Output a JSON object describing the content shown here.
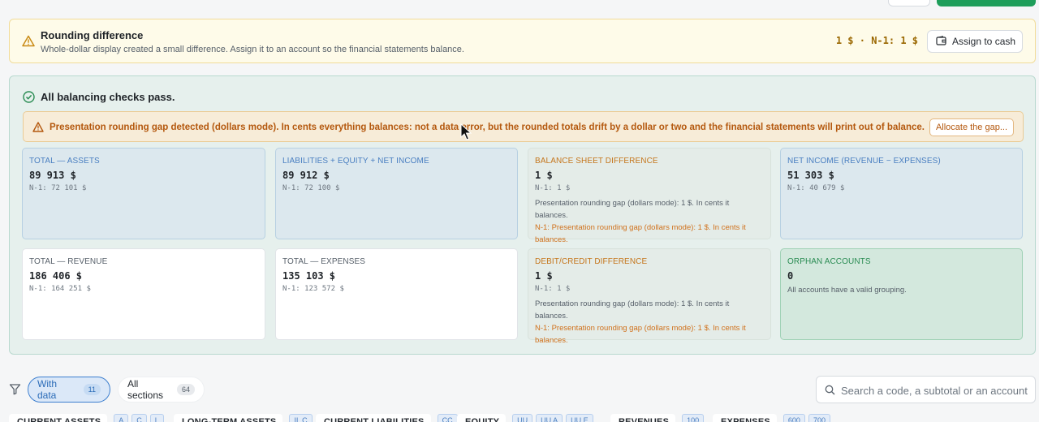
{
  "rounding_banner": {
    "title": "Rounding difference",
    "subtitle": "Whole-dollar display created a small difference. Assign it to an account so the financial statements balance.",
    "amount": "1 $ · N-1: 1 $",
    "assign_label": "Assign to cash"
  },
  "checks": {
    "title": "All balancing checks pass.",
    "alert_text": "Presentation rounding gap detected (dollars mode). In cents everything balances: not a data error, but the rounded totals drift by a dollar or two and the financial statements will print out of balance.",
    "alert_button": "Allocate the gap..."
  },
  "cards": [
    {
      "label": "TOTAL — ASSETS",
      "value": "89 913 $",
      "n1": "N-1: 72 101 $"
    },
    {
      "label": "LIABILITIES + EQUITY + NET INCOME",
      "value": "89 912 $",
      "n1": "N-1: 72 100 $"
    },
    {
      "label": "BALANCE SHEET DIFFERENCE",
      "value": "1 $",
      "n1": "N-1: 1 $",
      "note": "Presentation rounding gap (dollars mode): 1 $. In cents it balances.",
      "note_n1": "N-1: Presentation rounding gap (dollars mode): 1 $. In cents it balances."
    },
    {
      "label": "NET INCOME (REVENUE − EXPENSES)",
      "value": "51 303 $",
      "n1": "N-1: 40 679 $"
    },
    {
      "label": "TOTAL — REVENUE",
      "value": "186 406 $",
      "n1": "N-1: 164 251 $"
    },
    {
      "label": "TOTAL — EXPENSES",
      "value": "135 103 $",
      "n1": "N-1: 123 572 $"
    },
    {
      "label": "DEBIT/CREDIT DIFFERENCE",
      "value": "1 $",
      "n1": "N-1: 1 $",
      "note": "Presentation rounding gap (dollars mode): 1 $. In cents it balances.",
      "note_n1": "N-1: Presentation rounding gap (dollars mode): 1 $. In cents it balances."
    },
    {
      "label": "ORPHAN ACCOUNTS",
      "value": "0",
      "desc": "All accounts have a valid grouping."
    }
  ],
  "filters": {
    "with_data_label": "With data",
    "with_data_count": "11",
    "all_sections_label": "All sections",
    "all_sections_count": "64",
    "search_placeholder": "Search a code, a subtotal or an account"
  },
  "sections": [
    {
      "name": "CURRENT ASSETS",
      "chips": [
        "A",
        "C",
        "L"
      ]
    },
    {
      "name": "LONG-TERM ASSETS",
      "chips": [
        "IL C"
      ]
    },
    {
      "name": "CURRENT LIABILITIES",
      "chips": [
        "CC"
      ]
    },
    {
      "name": "EQUITY",
      "chips": [
        "UU",
        "UU A",
        "UU E"
      ]
    },
    {
      "name": "REVENUES",
      "chips": [
        "100"
      ]
    },
    {
      "name": "EXPENSES",
      "chips": [
        "600",
        "700"
      ]
    }
  ],
  "colors": {
    "accent_blue": "#2b6cb8",
    "success_green": "#2a8c53",
    "warning_orange": "#b4580e",
    "primary_green_button": "#1e9e5a"
  }
}
